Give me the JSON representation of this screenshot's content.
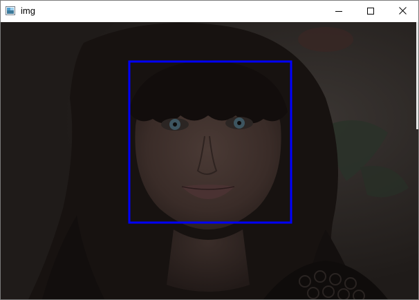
{
  "window": {
    "title": "img",
    "icon": "opencv-window-icon",
    "controls": {
      "minimize": "minimize-icon",
      "maximize": "maximize-icon",
      "close": "close-icon"
    }
  },
  "image": {
    "subject": "face-photo",
    "detection_box_color": "#0000ff"
  }
}
